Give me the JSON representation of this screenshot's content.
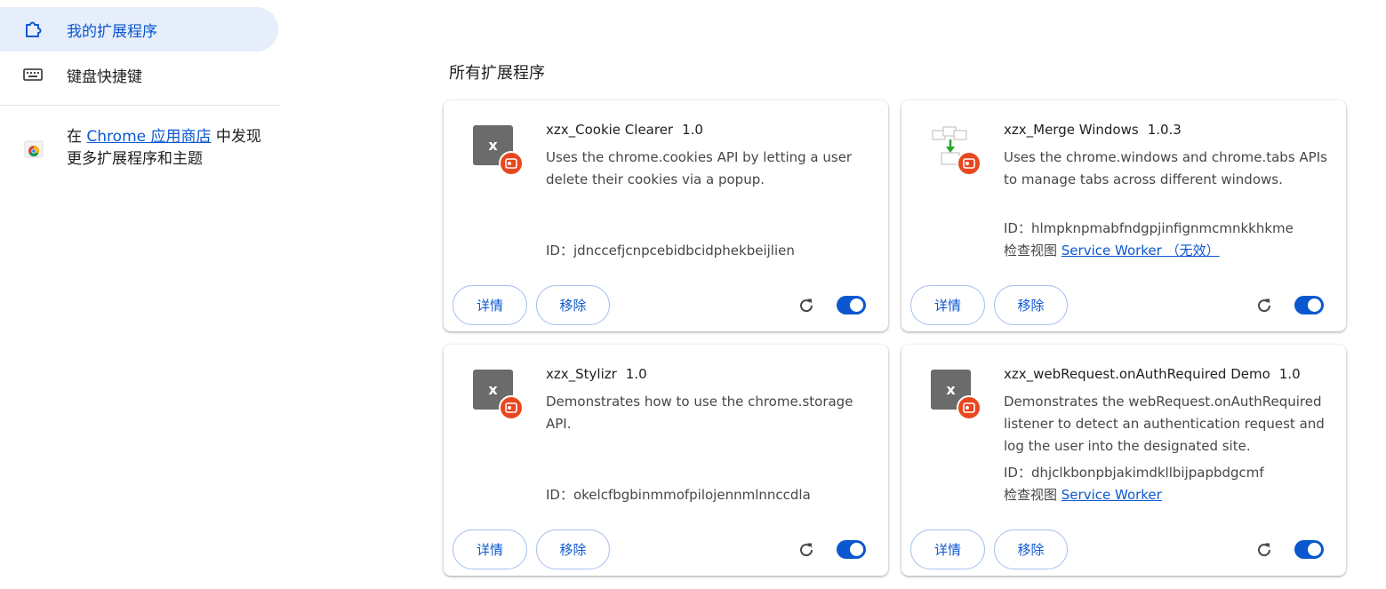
{
  "sidebar": {
    "items": [
      {
        "label": "我的扩展程序",
        "icon": "puzzle-icon",
        "active": true
      },
      {
        "label": "键盘快捷键",
        "icon": "keyboard-icon",
        "active": false
      }
    ],
    "store_promo": {
      "prefix": "在 ",
      "link": "Chrome 应用商店",
      "suffix": " 中发现更多扩展程序和主题"
    }
  },
  "main": {
    "section_title": "所有扩展程序",
    "cards": [
      {
        "name": "xzx_Cookie Clearer",
        "version": "1.0",
        "icon_letter": "x",
        "description": "Uses the chrome.cookies API by letting a user delete their cookies via a popup.",
        "id": "ID：jdnccefjcnpcebidbcidphekbeijlien",
        "inspect_label": "",
        "inspect_link": "",
        "details_label": "详情",
        "remove_label": "移除",
        "enabled": true
      },
      {
        "name": "xzx_Merge Windows",
        "version": "1.0.3",
        "icon_letter": "",
        "description": "Uses the chrome.windows and chrome.tabs APIs to manage tabs across different windows.",
        "id": "ID：hlmpknpmabfndgpjinfignmcmnkkhkme",
        "inspect_label": "检查视图 ",
        "inspect_link": "Service Worker （无效）",
        "details_label": "详情",
        "remove_label": "移除",
        "enabled": true
      },
      {
        "name": "xzx_Stylizr",
        "version": "1.0",
        "icon_letter": "x",
        "description": "Demonstrates how to use the chrome.storage API.",
        "id": "ID：okelcfbgbinmmofpilojennmlnnccdla",
        "inspect_label": "",
        "inspect_link": "",
        "details_label": "详情",
        "remove_label": "移除",
        "enabled": true
      },
      {
        "name": "xzx_webRequest.onAuthRequired Demo",
        "version": "1.0",
        "icon_letter": "x",
        "description": "Demonstrates the webRequest.onAuthRequired listener to detect an authentication request and log the user into the designated site.",
        "id": "ID：dhjclkbonpbjakimdkllbijpapbdgcmf",
        "inspect_label": "检查视图 ",
        "inspect_link": "Service Worker",
        "details_label": "详情",
        "remove_label": "移除",
        "enabled": true
      }
    ]
  },
  "colors": {
    "accent": "#0b57d0",
    "active_nav_bg": "#e6eefb",
    "badge": "#e8471f",
    "icon_gray": "#6b6b6b"
  }
}
